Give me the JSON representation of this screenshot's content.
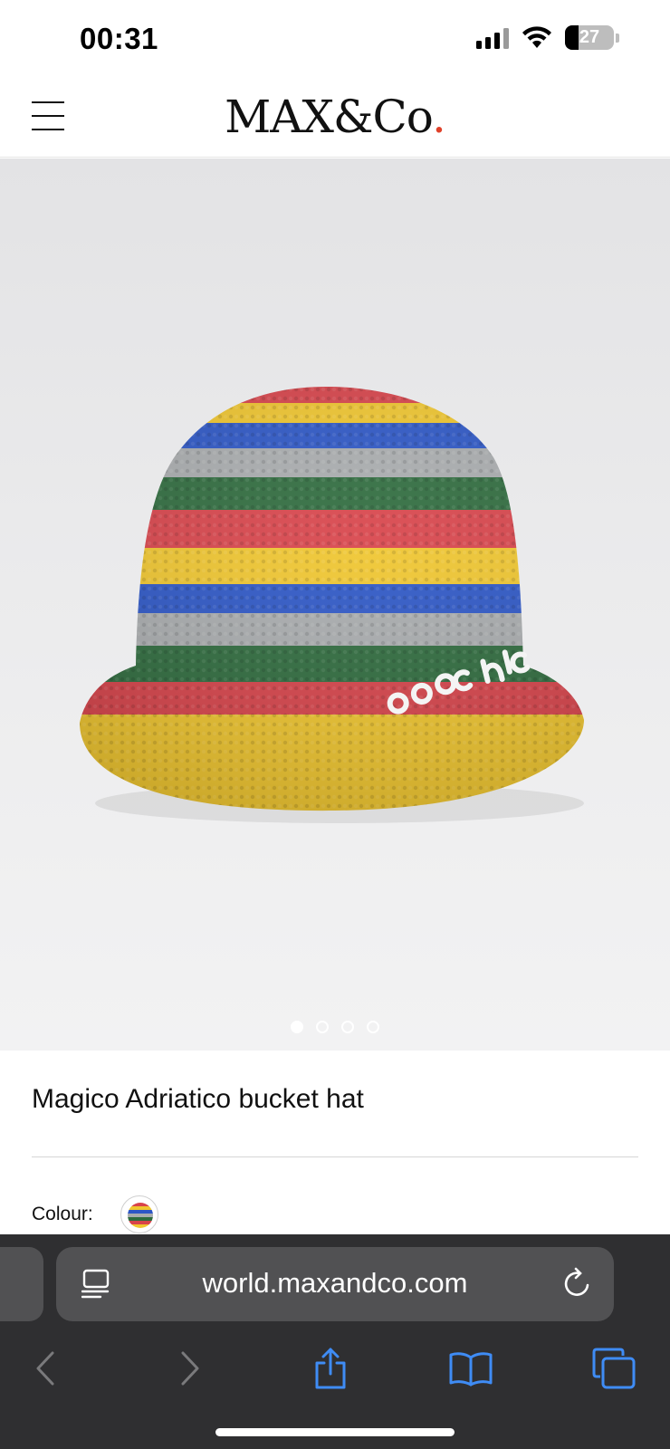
{
  "status_bar": {
    "time": "00:31",
    "battery_percent": "27",
    "icons": [
      "cellular-signal-icon",
      "wifi-icon",
      "battery-icon"
    ]
  },
  "header": {
    "logo_text": "MAX&Co",
    "logo_dot": ".",
    "logo_dot_color": "#e0412a",
    "menu_icon": "hamburger-menu-icon"
  },
  "product": {
    "image_description_icon": "striped-crochet-bucket-hat-image",
    "carousel": {
      "total": 4,
      "active_index": 0
    },
    "title": "Magico Adriatico bucket hat",
    "colour_label": "Colour:",
    "selected_colour_swatch": "multicolour-stripes"
  },
  "browser": {
    "url": "world.maxandco.com",
    "icons": [
      "reader-view-icon",
      "reload-icon",
      "back-icon",
      "forward-icon",
      "share-icon",
      "bookmarks-icon",
      "tabs-icon"
    ],
    "toolbar_color": "#2f2f31",
    "field_color": "#515153",
    "accent": "#3f8cf5"
  },
  "colors": {
    "hat_red": "#d8434a",
    "hat_yellow": "#f0c62e",
    "hat_blue": "#2c56c6",
    "hat_grey": "#a9acae",
    "hat_green": "#2e6b3d"
  }
}
